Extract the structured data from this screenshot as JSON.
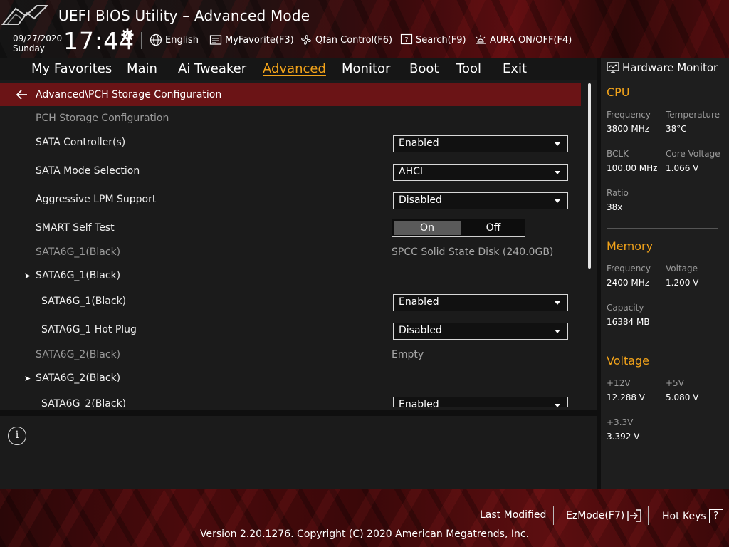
{
  "header": {
    "title": "UEFI BIOS Utility – Advanced Mode",
    "date": "09/27/2020",
    "day": "Sunday",
    "time": "17:44",
    "items": {
      "language": "English",
      "favorite": "MyFavorite(F3)",
      "qfan": "Qfan Control(F6)",
      "search": "Search(F9)",
      "aura": "AURA ON/OFF(F4)"
    }
  },
  "menu": {
    "tabs": [
      "My Favorites",
      "Main",
      "Ai Tweaker",
      "Advanced",
      "Monitor",
      "Boot",
      "Tool",
      "Exit"
    ],
    "active": "Advanced"
  },
  "breadcrumb": "Advanced\\PCH Storage Configuration",
  "settings": {
    "section_title": "PCH Storage Configuration",
    "sata_controller": {
      "label": "SATA Controller(s)",
      "value": "Enabled"
    },
    "sata_mode": {
      "label": "SATA Mode Selection",
      "value": "AHCI"
    },
    "aggressive_lpm": {
      "label": "Aggressive LPM Support",
      "value": "Disabled"
    },
    "smart_self_test": {
      "label": "SMART Self Test",
      "on": "On",
      "off": "Off"
    },
    "sata1_info": {
      "label": "SATA6G_1(Black)",
      "value": "SPCC Solid State Disk (240.0GB)"
    },
    "sata1_group": "SATA6G_1(Black)",
    "sata1_enable": {
      "label": "SATA6G_1(Black)",
      "value": "Enabled"
    },
    "sata1_hotplug": {
      "label": "SATA6G_1 Hot Plug",
      "value": "Disabled"
    },
    "sata2_info": {
      "label": "SATA6G_2(Black)",
      "value": "Empty"
    },
    "sata2_group": "SATA6G_2(Black)",
    "sata2_enable": {
      "label": "SATA6G_2(Black)",
      "value": "Enabled"
    }
  },
  "info": {
    "icon_text": "i"
  },
  "hardware_monitor": {
    "title": "Hardware Monitor",
    "cpu": {
      "heading": "CPU",
      "frequency_label": "Frequency",
      "frequency": "3800 MHz",
      "temperature_label": "Temperature",
      "temperature": "38°C",
      "bclk_label": "BCLK",
      "bclk": "100.00 MHz",
      "core_voltage_label": "Core Voltage",
      "core_voltage": "1.066 V",
      "ratio_label": "Ratio",
      "ratio": "38x"
    },
    "memory": {
      "heading": "Memory",
      "frequency_label": "Frequency",
      "frequency": "2400 MHz",
      "voltage_label": "Voltage",
      "voltage": "1.200 V",
      "capacity_label": "Capacity",
      "capacity": "16384 MB"
    },
    "voltage": {
      "heading": "Voltage",
      "v12_label": "+12V",
      "v12": "12.288 V",
      "v5_label": "+5V",
      "v5": "5.080 V",
      "v33_label": "+3.3V",
      "v33": "3.392 V"
    }
  },
  "footer": {
    "last_modified": "Last Modified",
    "ezmode": "EzMode(F7)",
    "hotkeys": "Hot Keys",
    "hotkeys_key": "?",
    "copyright": "Version 2.20.1276. Copyright (C) 2020 American Megatrends, Inc."
  },
  "colors": {
    "accent": "#f2a31a",
    "breadcrumb_bg": "#6b1416",
    "brand_red": "#5a0d10"
  }
}
